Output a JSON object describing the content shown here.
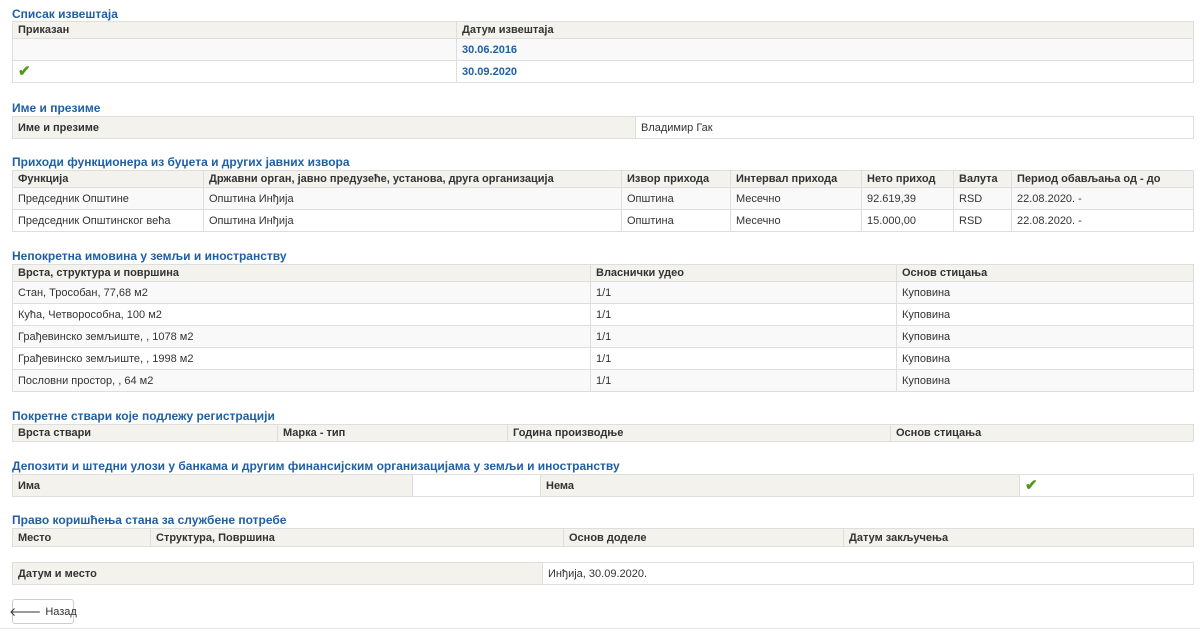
{
  "reports": {
    "title": "Списак извештаја",
    "headers": [
      "Приказан",
      "Датум извештаја"
    ],
    "rows": [
      {
        "shown": false,
        "date": "30.06.2016"
      },
      {
        "shown": true,
        "date": "30.09.2020"
      }
    ]
  },
  "name_section": {
    "title": "Име и презиме",
    "label": "Име и презиме",
    "value": "Владимир Гак"
  },
  "income": {
    "title": "Приходи функционера из буџета и других јавних извора",
    "headers": [
      "Функција",
      "Државни орган, јавно предузеће, установа, друга организација",
      "Извор прихода",
      "Интервал прихода",
      "Нето приход",
      "Валута",
      "Период обављања од - до"
    ],
    "rows": [
      [
        "Председник Општине",
        "Општина Инђија",
        "Општина",
        "Месечно",
        "92.619,39",
        "RSD",
        "22.08.2020. -"
      ],
      [
        "Председник Општинског већа",
        "Општина Инђија",
        "Општина",
        "Месечно",
        "15.000,00",
        "RSD",
        "22.08.2020. -"
      ]
    ]
  },
  "property": {
    "title": "Непокретна имовина у земљи и иностранству",
    "headers": [
      "Врста, структура и површина",
      "Власнички удео",
      "Основ стицања"
    ],
    "rows": [
      [
        "Стан, Трособан, 77,68 м2",
        "1/1",
        "Куповина"
      ],
      [
        "Кућа, Четворособна, 100 м2",
        "1/1",
        "Куповина"
      ],
      [
        "Грађевинско земљиште, , 1078 м2",
        "1/1",
        "Куповина"
      ],
      [
        "Грађевинско земљиште, , 1998 м2",
        "1/1",
        "Куповина"
      ],
      [
        "Пословни простор, , 64 м2",
        "1/1",
        "Куповина"
      ]
    ]
  },
  "movables": {
    "title": "Покретне ствари које подлежу регистрацији",
    "headers": [
      "Врста ствари",
      "Марка - тип",
      "Година производње",
      "Основ стицања"
    ]
  },
  "deposits": {
    "title": "Депозити и штедни улози у банкама и другим финансијским организацијама у земљи и иностранству",
    "has_label": "Има",
    "none_label": "Нема",
    "has_checked": false,
    "none_checked": true
  },
  "apartment": {
    "title": "Право коришћења стана за службене потребе",
    "headers": [
      "Место",
      "Структура, Површина",
      "Основ доделе",
      "Датум закључења"
    ]
  },
  "date_place": {
    "label": "Датум и место",
    "value": "Инђија, 30.09.2020."
  },
  "back_button": {
    "label": "Назад"
  },
  "colors": {
    "section_title": "#1f5fa3",
    "header_bg": "#f3f2ec",
    "check": "#4f9a1b"
  }
}
